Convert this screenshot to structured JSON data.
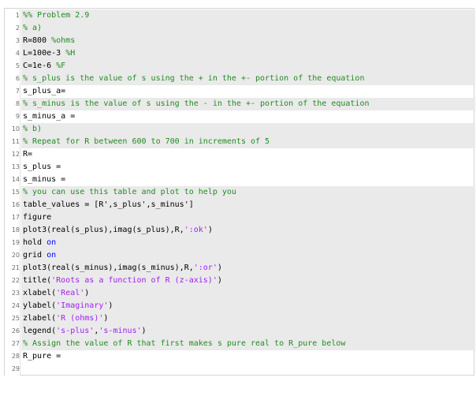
{
  "editor": {
    "lines": [
      {
        "n": "1",
        "shaded": true,
        "tokens": [
          {
            "t": "%% Problem 2.9",
            "c": "comment"
          }
        ]
      },
      {
        "n": "2",
        "shaded": true,
        "tokens": [
          {
            "t": "% a)",
            "c": "comment"
          }
        ]
      },
      {
        "n": "3",
        "shaded": true,
        "tokens": [
          {
            "t": "R=800 ",
            "c": ""
          },
          {
            "t": "%ohms",
            "c": "comment"
          }
        ]
      },
      {
        "n": "4",
        "shaded": true,
        "tokens": [
          {
            "t": "L=100e-3 ",
            "c": ""
          },
          {
            "t": "%H",
            "c": "comment"
          }
        ]
      },
      {
        "n": "5",
        "shaded": true,
        "tokens": [
          {
            "t": "C=1e-6 ",
            "c": ""
          },
          {
            "t": "%F",
            "c": "comment"
          }
        ]
      },
      {
        "n": "6",
        "shaded": true,
        "tokens": [
          {
            "t": "% s_plus is the value of s using the + in the +- portion of the equation",
            "c": "comment"
          }
        ]
      },
      {
        "n": "7",
        "shaded": false,
        "tokens": [
          {
            "t": "s_plus_a=",
            "c": ""
          }
        ]
      },
      {
        "n": "8",
        "shaded": true,
        "tokens": [
          {
            "t": "% s_minus is the value of s using the - in the +- portion of the equation",
            "c": "comment"
          }
        ]
      },
      {
        "n": "9",
        "shaded": false,
        "tokens": [
          {
            "t": "s_minus_a =",
            "c": ""
          }
        ]
      },
      {
        "n": "10",
        "shaded": true,
        "tokens": [
          {
            "t": "% b)",
            "c": "comment"
          }
        ]
      },
      {
        "n": "11",
        "shaded": true,
        "tokens": [
          {
            "t": "% Repeat for R between 600 to 700 in increments of 5",
            "c": "comment"
          }
        ]
      },
      {
        "n": "12",
        "shaded": false,
        "tokens": [
          {
            "t": "R=",
            "c": ""
          }
        ]
      },
      {
        "n": "13",
        "shaded": false,
        "tokens": [
          {
            "t": "s_plus =",
            "c": ""
          }
        ]
      },
      {
        "n": "14",
        "shaded": false,
        "tokens": [
          {
            "t": "s_minus =",
            "c": ""
          }
        ]
      },
      {
        "n": "15",
        "shaded": true,
        "tokens": [
          {
            "t": "% you can use this table and plot to help you",
            "c": "comment"
          }
        ]
      },
      {
        "n": "16",
        "shaded": true,
        "tokens": [
          {
            "t": "table_values = [R',s_plus',s_minus']",
            "c": ""
          }
        ]
      },
      {
        "n": "17",
        "shaded": true,
        "tokens": [
          {
            "t": "figure",
            "c": ""
          }
        ]
      },
      {
        "n": "18",
        "shaded": true,
        "tokens": [
          {
            "t": "plot3(real(s_plus),imag(s_plus),R,",
            "c": ""
          },
          {
            "t": "':ok'",
            "c": "string"
          },
          {
            "t": ")",
            "c": ""
          }
        ]
      },
      {
        "n": "19",
        "shaded": true,
        "tokens": [
          {
            "t": "hold ",
            "c": ""
          },
          {
            "t": "on",
            "c": "keyword"
          }
        ]
      },
      {
        "n": "20",
        "shaded": true,
        "tokens": [
          {
            "t": "grid ",
            "c": ""
          },
          {
            "t": "on",
            "c": "keyword"
          }
        ]
      },
      {
        "n": "21",
        "shaded": true,
        "tokens": [
          {
            "t": "plot3(real(s_minus),imag(s_minus),R,",
            "c": ""
          },
          {
            "t": "':or'",
            "c": "string"
          },
          {
            "t": ")",
            "c": ""
          }
        ]
      },
      {
        "n": "22",
        "shaded": true,
        "tokens": [
          {
            "t": "title(",
            "c": ""
          },
          {
            "t": "'Roots as a function of R (z-axis)'",
            "c": "string"
          },
          {
            "t": ")",
            "c": ""
          }
        ]
      },
      {
        "n": "23",
        "shaded": true,
        "tokens": [
          {
            "t": "xlabel(",
            "c": ""
          },
          {
            "t": "'Real'",
            "c": "string"
          },
          {
            "t": ")",
            "c": ""
          }
        ]
      },
      {
        "n": "24",
        "shaded": true,
        "tokens": [
          {
            "t": "ylabel(",
            "c": ""
          },
          {
            "t": "'Imaginary'",
            "c": "string"
          },
          {
            "t": ")",
            "c": ""
          }
        ]
      },
      {
        "n": "25",
        "shaded": true,
        "tokens": [
          {
            "t": "zlabel(",
            "c": ""
          },
          {
            "t": "'R (ohms)'",
            "c": "string"
          },
          {
            "t": ")",
            "c": ""
          }
        ]
      },
      {
        "n": "26",
        "shaded": true,
        "tokens": [
          {
            "t": "legend(",
            "c": ""
          },
          {
            "t": "'s-plus'",
            "c": "string"
          },
          {
            "t": ",",
            "c": ""
          },
          {
            "t": "'s-minus'",
            "c": "string"
          },
          {
            "t": ")",
            "c": ""
          }
        ]
      },
      {
        "n": "27",
        "shaded": true,
        "tokens": [
          {
            "t": "% Assign the value of R that first makes s pure real to R_pure below",
            "c": "comment"
          }
        ]
      },
      {
        "n": "28",
        "shaded": false,
        "tokens": [
          {
            "t": "R_pure =",
            "c": ""
          }
        ]
      },
      {
        "n": "29",
        "shaded": false,
        "tokens": []
      }
    ]
  },
  "colors": {
    "comment": "#228b22",
    "string": "#a020f0",
    "keyword": "#0000ff",
    "shade": "#eaeaea",
    "border": "#d4d4d4"
  }
}
